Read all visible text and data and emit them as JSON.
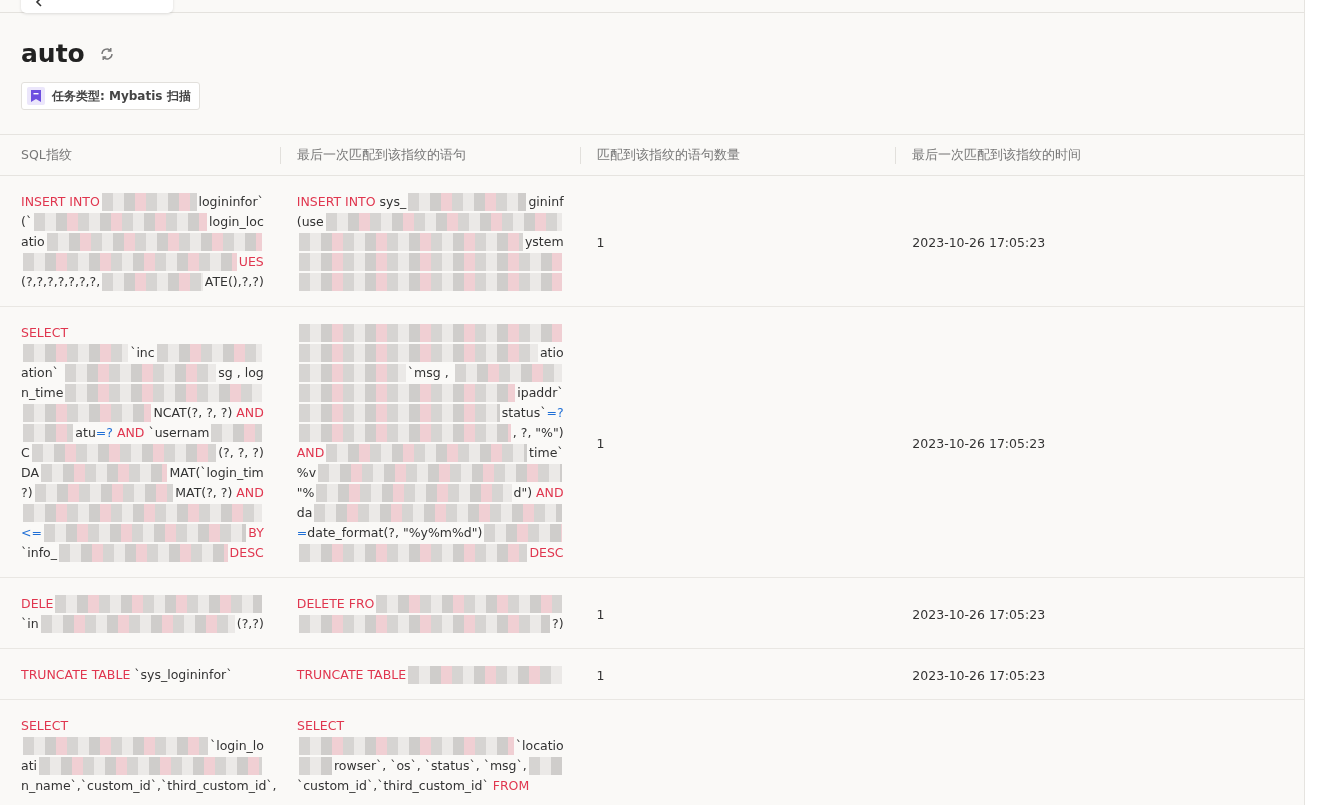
{
  "title": "auto",
  "task_type": {
    "label": "任务类型: Mybatis 扫描"
  },
  "table": {
    "columns": [
      "SQL指纹",
      "最后一次匹配到该指纹的语句",
      "匹配到该指纹的语句数量",
      "最后一次匹配到该指纹的时间"
    ],
    "rows": [
      {
        "fingerprint": [
          [
            {
              "kind": "keyword",
              "text": "INSERT INTO"
            },
            {
              "kind": "redacted"
            },
            {
              "kind": "plain",
              "text": "logininfor`"
            }
          ],
          [
            {
              "kind": "plain",
              "text": "(`"
            },
            {
              "kind": "redacted"
            },
            {
              "kind": "plain",
              "text": "login_loc"
            }
          ],
          [
            {
              "kind": "plain",
              "text": "atio"
            },
            {
              "kind": "redacted"
            }
          ],
          [
            {
              "kind": "redacted"
            },
            {
              "kind": "keyword",
              "text": "UES"
            }
          ],
          [
            {
              "kind": "plain",
              "text": "(?,?,?,?,?,?,?,"
            },
            {
              "kind": "redacted"
            },
            {
              "kind": "plain",
              "text": "ATE(),?,?)"
            }
          ]
        ],
        "statement": [
          [
            {
              "kind": "keyword",
              "text": "INSERT INTO"
            },
            {
              "kind": "plain",
              "text": " sys_"
            },
            {
              "kind": "redacted"
            },
            {
              "kind": "plain",
              "text": "gininf"
            }
          ],
          [
            {
              "kind": "plain",
              "text": "(use"
            },
            {
              "kind": "redacted"
            }
          ],
          [
            {
              "kind": "redacted"
            },
            {
              "kind": "plain",
              "text": "ystem"
            }
          ],
          [
            {
              "kind": "redacted"
            }
          ],
          [
            {
              "kind": "redacted"
            }
          ]
        ],
        "count": "1",
        "time": "2023-10-26 17:05:23"
      },
      {
        "fingerprint": [
          [
            {
              "kind": "keyword",
              "text": "SELECT"
            }
          ],
          [
            {
              "kind": "redacted"
            },
            {
              "kind": "plain",
              "text": "`inc"
            },
            {
              "kind": "redacted"
            }
          ],
          [
            {
              "kind": "plain",
              "text": "ation` "
            },
            {
              "kind": "redacted"
            },
            {
              "kind": "plain",
              "text": "sg , log"
            }
          ],
          [
            {
              "kind": "plain",
              "text": "n_time"
            },
            {
              "kind": "redacted"
            }
          ],
          [
            {
              "kind": "redacted"
            },
            {
              "kind": "plain",
              "text": "NCAT(?, ?, ?) "
            },
            {
              "kind": "keyword",
              "text": "AND"
            }
          ],
          [
            {
              "kind": "redacted"
            },
            {
              "kind": "plain",
              "text": "atu"
            },
            {
              "kind": "operator",
              "text": "=?"
            },
            {
              "kind": "keyword",
              "text": " AND"
            },
            {
              "kind": "plain",
              "text": " `usernam"
            },
            {
              "kind": "redacted"
            }
          ],
          [
            {
              "kind": "plain",
              "text": "C"
            },
            {
              "kind": "redacted"
            },
            {
              "kind": "plain",
              "text": "(?, ?, ?)"
            }
          ],
          [
            {
              "kind": "plain",
              "text": "DA"
            },
            {
              "kind": "redacted"
            },
            {
              "kind": "plain",
              "text": "MAT(`login_tim"
            }
          ],
          [
            {
              "kind": "plain",
              "text": "?)"
            },
            {
              "kind": "redacted"
            },
            {
              "kind": "plain",
              "text": "MAT(?, ?) "
            },
            {
              "kind": "keyword",
              "text": "AND"
            }
          ],
          [
            {
              "kind": "redacted"
            }
          ],
          [
            {
              "kind": "operator",
              "text": "<="
            },
            {
              "kind": "redacted"
            },
            {
              "kind": "keyword",
              "text": "BY"
            }
          ],
          [
            {
              "kind": "plain",
              "text": "`info_"
            },
            {
              "kind": "redacted"
            },
            {
              "kind": "keyword",
              "text": "DESC"
            }
          ]
        ],
        "statement": [
          [
            {
              "kind": "redacted"
            }
          ],
          [
            {
              "kind": "redacted"
            },
            {
              "kind": "plain",
              "text": "atio"
            }
          ],
          [
            {
              "kind": "redacted"
            },
            {
              "kind": "plain",
              "text": "`msg , "
            },
            {
              "kind": "redacted"
            }
          ],
          [
            {
              "kind": "redacted"
            },
            {
              "kind": "plain",
              "text": "ipaddr`"
            }
          ],
          [
            {
              "kind": "redacted"
            },
            {
              "kind": "plain",
              "text": "status`"
            },
            {
              "kind": "operator",
              "text": "=?"
            }
          ],
          [
            {
              "kind": "redacted"
            },
            {
              "kind": "plain",
              "text": ", ?, \"%\")"
            }
          ],
          [
            {
              "kind": "keyword",
              "text": "AND"
            },
            {
              "kind": "redacted"
            },
            {
              "kind": "plain",
              "text": "time`"
            }
          ],
          [
            {
              "kind": "plain",
              "text": "%v"
            },
            {
              "kind": "redacted"
            }
          ],
          [
            {
              "kind": "plain",
              "text": "\"%"
            },
            {
              "kind": "redacted"
            },
            {
              "kind": "plain",
              "text": "d\") "
            },
            {
              "kind": "keyword",
              "text": "AND"
            }
          ],
          [
            {
              "kind": "plain",
              "text": "da"
            },
            {
              "kind": "redacted"
            }
          ],
          [
            {
              "kind": "operator",
              "text": "="
            },
            {
              "kind": "plain",
              "text": "date_format(?, \"%y%m%d\")"
            },
            {
              "kind": "redacted"
            }
          ],
          [
            {
              "kind": "redacted"
            },
            {
              "kind": "keyword",
              "text": "DESC"
            }
          ]
        ],
        "count": "1",
        "time": "2023-10-26 17:05:23"
      },
      {
        "fingerprint": [
          [
            {
              "kind": "keyword",
              "text": "DELE"
            },
            {
              "kind": "redacted"
            }
          ],
          [
            {
              "kind": "plain",
              "text": "`in"
            },
            {
              "kind": "redacted"
            },
            {
              "kind": "plain",
              "text": "(?,?)"
            }
          ]
        ],
        "statement": [
          [
            {
              "kind": "keyword",
              "text": "DELETE FRO"
            },
            {
              "kind": "redacted"
            }
          ],
          [
            {
              "kind": "redacted"
            },
            {
              "kind": "plain",
              "text": "?)"
            }
          ]
        ],
        "count": "1",
        "time": "2023-10-26 17:05:23"
      },
      {
        "fingerprint": [
          [
            {
              "kind": "keyword",
              "text": "TRUNCATE TABLE"
            },
            {
              "kind": "plain",
              "text": " `sys_logininfor`"
            }
          ]
        ],
        "statement": [
          [
            {
              "kind": "keyword",
              "text": "TRUNCATE TABLE"
            },
            {
              "kind": "redacted"
            }
          ]
        ],
        "count": "1",
        "time": "2023-10-26 17:05:23"
      },
      {
        "fingerprint": [
          [
            {
              "kind": "keyword",
              "text": "SELECT"
            }
          ],
          [
            {
              "kind": "redacted"
            },
            {
              "kind": "plain",
              "text": "`login_lo"
            }
          ],
          [
            {
              "kind": "plain",
              "text": "ati"
            },
            {
              "kind": "redacted"
            }
          ],
          [
            {
              "kind": "plain",
              "text": "n_name`,`custom_id`,`third_custom_id`,"
            }
          ]
        ],
        "statement": [
          [
            {
              "kind": "keyword",
              "text": "SELECT"
            }
          ],
          [
            {
              "kind": "redacted"
            },
            {
              "kind": "plain",
              "text": "`locatio"
            }
          ],
          [
            {
              "kind": "redacted"
            },
            {
              "kind": "plain",
              "text": "rowser`, `os`, `status`, `msg`,"
            },
            {
              "kind": "redacted"
            }
          ],
          [
            {
              "kind": "plain",
              "text": "`custom_id`,`third_custom_id` "
            },
            {
              "kind": "keyword",
              "text": "FROM"
            }
          ]
        ]
      }
    ]
  }
}
